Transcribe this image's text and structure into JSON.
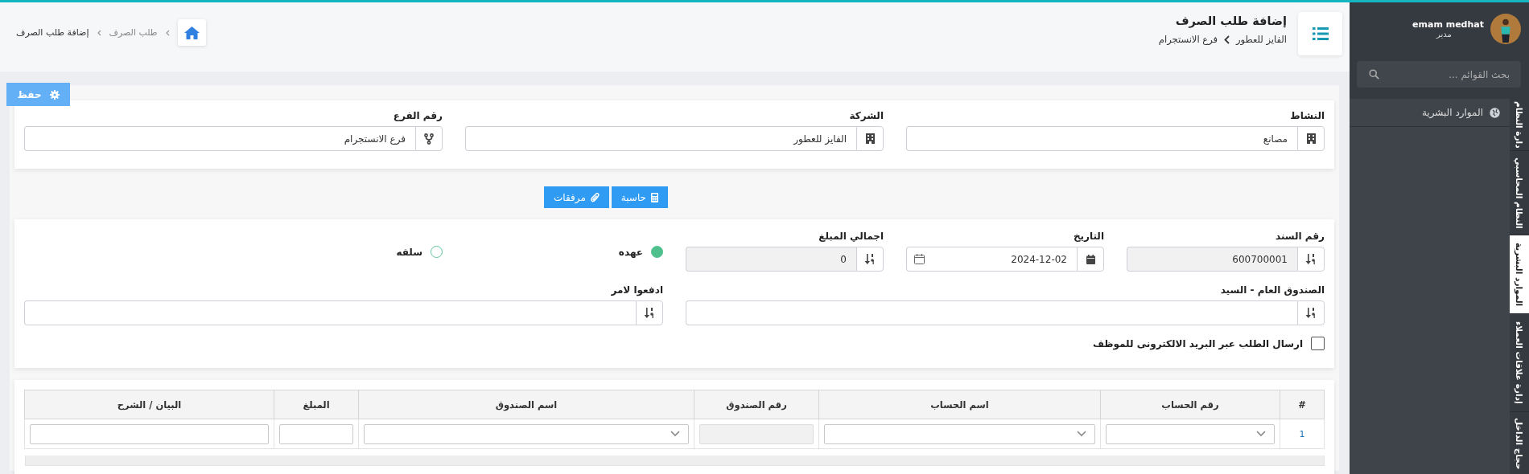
{
  "sidebar": {
    "user": {
      "name": "emam medhat",
      "role": "مدير"
    },
    "search": {
      "placeholder": "بحث القوائم ..."
    },
    "menu": [
      {
        "label": "الموارد البشرية"
      }
    ],
    "modules": [
      {
        "label": "دارة النظام",
        "selected": false
      },
      {
        "label": "النظام المحاسبي",
        "selected": false
      },
      {
        "label": "الموارد البشرية",
        "selected": true
      },
      {
        "label": "إدارة علاقات العملاء",
        "selected": false
      },
      {
        "label": "حجاج الداخل",
        "selected": false
      }
    ]
  },
  "header": {
    "title": "إضافة طلب الصرف",
    "path": [
      "الفايز للعطور",
      "فرع الانستجرام"
    ],
    "breadcrumb": [
      {
        "label": "طلب الصرف"
      },
      {
        "label": "إضافة طلب الصرف"
      }
    ]
  },
  "save_button": "حفظ",
  "org_fields": [
    {
      "kind": "building",
      "label": "النشاط",
      "value": "مصانع"
    },
    {
      "kind": "building",
      "label": "الشركة",
      "value": "الفايز للعطور"
    },
    {
      "kind": "branch",
      "label": "رقم الفرع",
      "value": "فرع الانستجرام"
    }
  ],
  "actions": [
    "حاسبة",
    "مرفقات"
  ],
  "voucher": {
    "fields": [
      {
        "kind": "number",
        "label": "رقم السند",
        "value": "600700001",
        "readonly": true
      },
      {
        "kind": "date",
        "label": "التاريخ",
        "value": "2024-12-02",
        "readonly": false
      },
      {
        "kind": "number",
        "label": "اجمالي المبلغ",
        "value": "0",
        "readonly": true
      }
    ],
    "types": [
      {
        "label": "عهده",
        "selected": true
      },
      {
        "label": "سلفه",
        "selected": false
      }
    ],
    "parties": [
      {
        "label": "الصندوق العام - السيد"
      },
      {
        "label": "ادفعوا لامر"
      }
    ],
    "email_checkbox": {
      "label": "ارسال الطلب عبر البريد الالكترونى للموظف",
      "checked": false
    }
  },
  "table": {
    "columns": [
      "#",
      "رقم الحساب",
      "اسم الحساب",
      "رقم الصندوق",
      "اسم الصندوق",
      "المبلغ",
      "البيان / الشرح"
    ],
    "rows": [
      {
        "number": "1",
        "cells": [
          {
            "kind": "select"
          },
          {
            "kind": "select"
          },
          {
            "kind": "readonly"
          },
          {
            "kind": "select"
          },
          {
            "kind": "input"
          },
          {
            "kind": "input"
          }
        ]
      }
    ]
  }
}
